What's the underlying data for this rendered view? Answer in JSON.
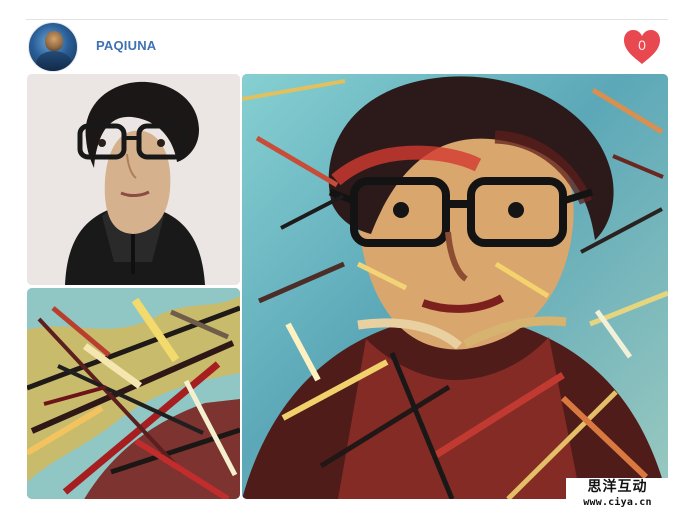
{
  "user": {
    "name": "PAQIUNA",
    "avatar_icon": "user-avatar"
  },
  "like": {
    "count": "0",
    "icon": "heart-icon",
    "color": "#e8484f"
  },
  "photos": {
    "original_icon": "portrait-photo",
    "detail_icon": "stylized-detail-photo",
    "main_icon": "stylized-portrait-photo"
  },
  "watermark": {
    "cn": "思洋互动",
    "url": "www.ciya.cn"
  },
  "colors": {
    "accent": "#3f72b5",
    "divider": "#e3e3e3"
  }
}
